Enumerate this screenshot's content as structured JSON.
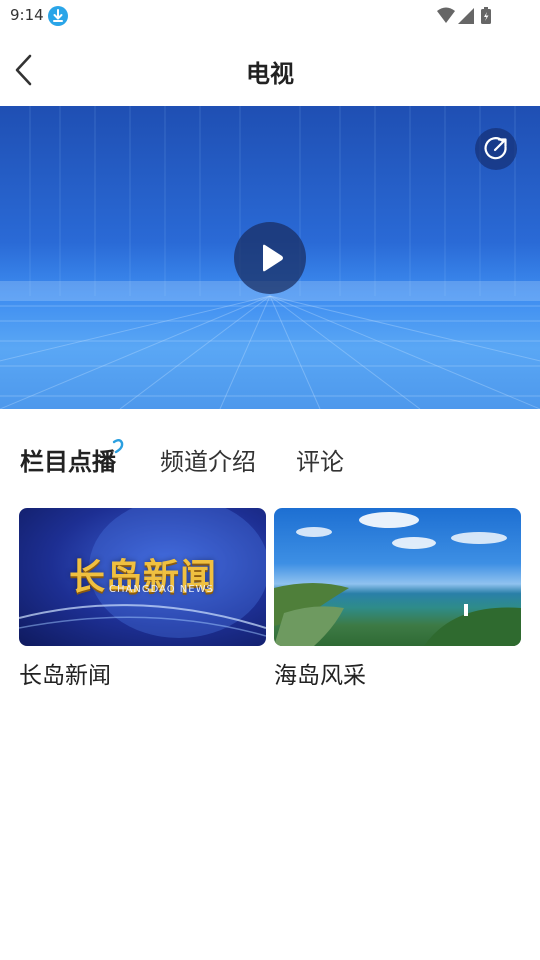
{
  "status_bar": {
    "time": "9:14"
  },
  "header": {
    "title": "电视"
  },
  "tabs": [
    {
      "label": "栏目点播",
      "active": true
    },
    {
      "label": "频道介绍",
      "active": false
    },
    {
      "label": "评论",
      "active": false
    }
  ],
  "programs": [
    {
      "title": "长岛新闻",
      "thumb_text": "长岛新闻",
      "thumb_subtext": "CHANGDAO NEWS"
    },
    {
      "title": "海岛风采"
    }
  ],
  "colors": {
    "accent": "#2aa5e8",
    "tab_indicator": "#2a9fe0"
  },
  "icons": {
    "back": "chevron-left-icon",
    "share": "share-icon",
    "play": "play-icon",
    "download": "download-icon"
  }
}
